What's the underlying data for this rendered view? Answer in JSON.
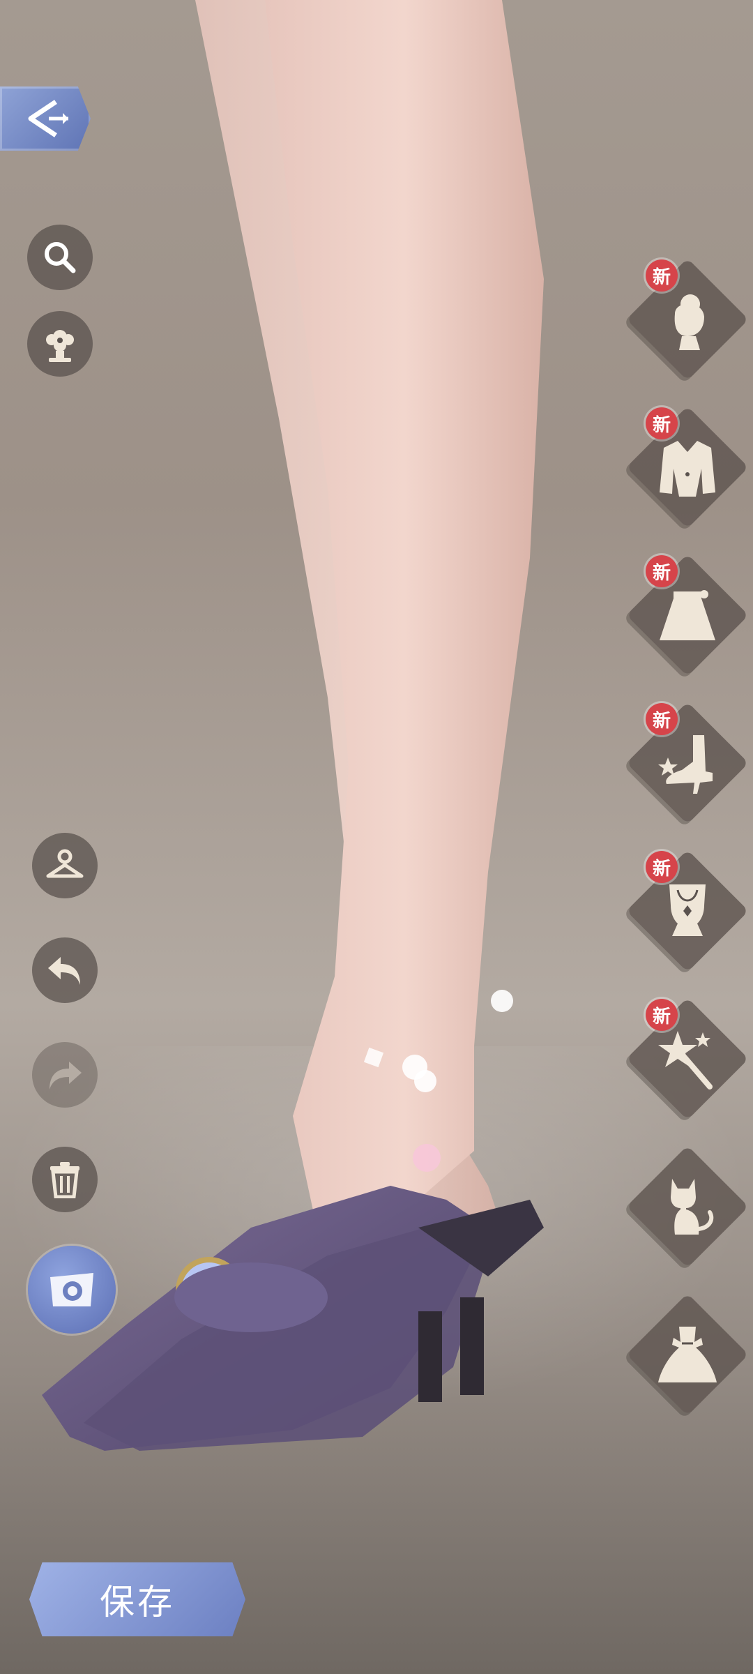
{
  "actions": {
    "save_label": "保存"
  },
  "categories": [
    {
      "icon": "hairstyle-icon",
      "badge": "新"
    },
    {
      "icon": "jacket-icon",
      "badge": "新"
    },
    {
      "icon": "skirt-icon",
      "badge": "新"
    },
    {
      "icon": "shoe-icon",
      "badge": "新"
    },
    {
      "icon": "necklace-icon",
      "badge": "新"
    },
    {
      "icon": "magic-wand-icon",
      "badge": "新"
    },
    {
      "icon": "cat-icon",
      "badge": ""
    },
    {
      "icon": "dress-icon",
      "badge": ""
    }
  ],
  "colors": {
    "accent": "#6c80c2",
    "badge": "#d6444a",
    "icon_fill": "#efe6d8"
  }
}
